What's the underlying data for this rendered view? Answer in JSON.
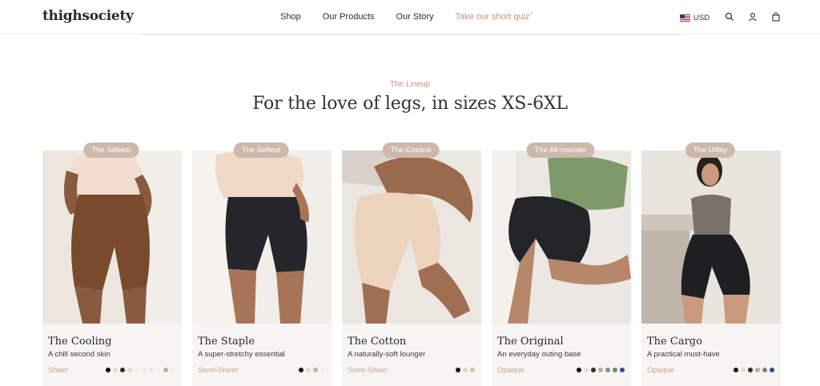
{
  "header": {
    "logo": "thighsociety",
    "nav": [
      "Shop",
      "Our Products",
      "Our Story",
      "Take our short quiz"
    ],
    "quiz_mark": "*",
    "currency": "USD"
  },
  "section": {
    "eyebrow": "The Lineup",
    "headline": "For the love of legs, in sizes XS-6XL"
  },
  "products": [
    {
      "badge": "The Silkiest",
      "title": "The Cooling",
      "subtitle": "A chill second skin",
      "opacity": "Sheer",
      "swatches": [
        "#111111",
        "#e8ddd2",
        "#3b2a24",
        "#e9d8c8",
        "#f3ede6",
        "#f0e8e2",
        "#ece4de",
        "#f4eee9",
        "#c8a99a",
        "#efe9e4"
      ]
    },
    {
      "badge": "The Softest",
      "title": "The Staple",
      "subtitle": "A super-stretchy essential",
      "opacity": "Semi-Sheer",
      "swatches": [
        "#111111",
        "#e6d8cc",
        "#c9b3a6",
        "#f1ebe6"
      ]
    },
    {
      "badge": "The Coziest",
      "title": "The Cotton",
      "subtitle": "A naturally-soft lounger",
      "opacity": "Semi-Sheer",
      "swatches": [
        "#111111",
        "#e8d5c4",
        "#d8c1b1"
      ]
    },
    {
      "badge": "The All-rounder",
      "title": "The Original",
      "subtitle": "An everyday outing base",
      "opacity": "Opaque",
      "swatches": [
        "#111111",
        "#e9ddd0",
        "#3b2a24",
        "#c6a998",
        "#8e8a86",
        "#6f8a72",
        "#2f4f8f"
      ]
    },
    {
      "badge": "The Utility",
      "title": "The Cargo",
      "subtitle": "A practical must-have",
      "opacity": "Opaque",
      "swatches": [
        "#111111",
        "#e8ddd0",
        "#3b2a24",
        "#c6a998",
        "#6f8a72",
        "#2f4f8f"
      ]
    }
  ],
  "colors": {
    "accent": "#c8907c",
    "badge": "#cdb8ac",
    "card_bg": "#f7f5f3"
  }
}
